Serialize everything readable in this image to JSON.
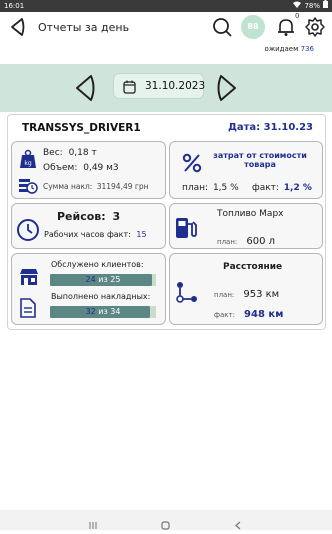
{
  "status": {
    "time": "16:01",
    "battery": "78%"
  },
  "header": {
    "title": "Отчеты за день",
    "avatar_text": "88",
    "notif_count": "0",
    "waiting_label": "ожидаем",
    "waiting_count": "736"
  },
  "datebar": {
    "date": "31.10.2023"
  },
  "main": {
    "driver": "TRANSSYS_DRIVER1",
    "date_label": "Дата: 31.10.23",
    "weight": {
      "weight_label": "Вес:",
      "weight_value": "0,18 т",
      "volume_label": "Объем:",
      "volume_value": "0,49 м3",
      "sum_label": "Сумма накл:",
      "sum_value": "31194,49 грн"
    },
    "cost": {
      "title": "затрат от стоимости товара",
      "plan_label": "план:",
      "plan_value": "1,5 %",
      "fact_label": "факт:",
      "fact_value": "1,2 %"
    },
    "trips": {
      "title": "Рейсов:",
      "count": "3",
      "hours_label": "Рабочих часов факт:",
      "hours_value": "15"
    },
    "fuel": {
      "title": "Топливо Марх",
      "plan_label": "план:",
      "plan_value": "600 л"
    },
    "clients": {
      "served_label": "Обслужено клиентов:",
      "served_done": "24",
      "served_of": "из",
      "served_total": "25",
      "served_fraction": 0.96,
      "invoices_label": "Выполнено накладных:",
      "invoices_done": "32",
      "invoices_of": "из",
      "invoices_total": "34",
      "invoices_fraction": 0.94
    },
    "distance": {
      "title": "Расстояние",
      "plan_label": "план:",
      "plan_value": "953 км",
      "fact_label": "факт:",
      "fact_value": "948 км"
    }
  },
  "colors": {
    "accent": "#1f2f8f",
    "datebar": "#cfe5dc",
    "bar": "#5d8782"
  }
}
